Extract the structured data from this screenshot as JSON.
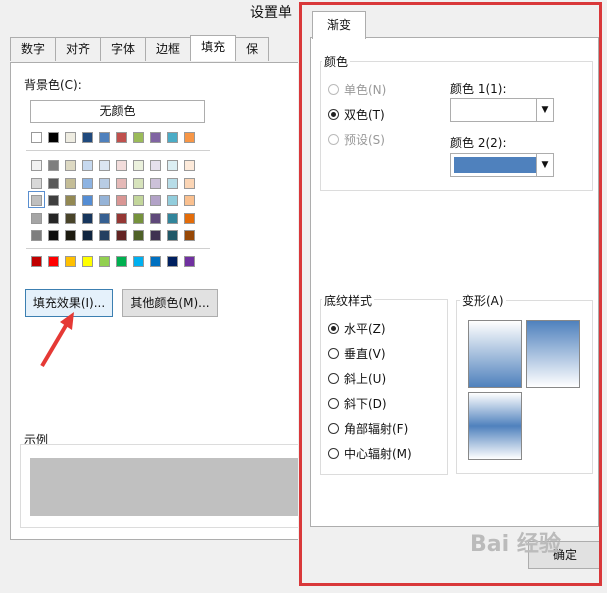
{
  "background_dialog": {
    "title": "设置单",
    "tabs": [
      "数字",
      "对齐",
      "字体",
      "边框",
      "填充",
      "保"
    ],
    "active_tab": "填充",
    "background_color_label": "背景色(C):",
    "no_color_label": "无颜色",
    "fill_effects_button": "填充效果(I)...",
    "other_colors_button": "其他颜色(M)...",
    "example_label": "示例",
    "theme_top_row": [
      "#ffffff",
      "#000000",
      "#eeece1",
      "#1f497d",
      "#4f81bd",
      "#c0504d",
      "#9bbb59",
      "#8064a2",
      "#4bacc6",
      "#f79646"
    ],
    "theme_rows": [
      [
        "#f2f2f2",
        "#7f7f7f",
        "#ddd9c3",
        "#c6d9f0",
        "#dbe5f1",
        "#f2dcdb",
        "#ebf1dd",
        "#e5e0ec",
        "#dbeef3",
        "#fdeada"
      ],
      [
        "#d8d8d8",
        "#595959",
        "#c4bd97",
        "#8db3e2",
        "#b8cce4",
        "#e5b9b7",
        "#d7e3bc",
        "#ccc1d9",
        "#b7dde8",
        "#fbd5b5"
      ],
      [
        "#bfbfbf",
        "#3f3f3f",
        "#938953",
        "#548dd4",
        "#95b3d7",
        "#d99694",
        "#c3d69b",
        "#b2a2c7",
        "#92cddc",
        "#fac08f"
      ],
      [
        "#a5a5a5",
        "#262626",
        "#494429",
        "#17365d",
        "#366092",
        "#953734",
        "#76923c",
        "#5f497a",
        "#31859b",
        "#e36c09"
      ],
      [
        "#7f7f7f",
        "#0c0c0c",
        "#1d1b10",
        "#0f243e",
        "#244061",
        "#632423",
        "#4f6128",
        "#3f3151",
        "#205867",
        "#974806"
      ]
    ],
    "standard_colors": [
      "#c00000",
      "#ff0000",
      "#ffc000",
      "#ffff00",
      "#92d050",
      "#00b050",
      "#00b0f0",
      "#0070c0",
      "#002060",
      "#7030a0"
    ],
    "example_fill": "#c0c0c0"
  },
  "fill_effects_dialog": {
    "tab": "渐变",
    "colors_group": "颜色",
    "color_options": [
      {
        "label": "单色(N)",
        "selected": false,
        "disabled": true
      },
      {
        "label": "双色(T)",
        "selected": true,
        "disabled": false
      },
      {
        "label": "预设(S)",
        "selected": false,
        "disabled": true
      }
    ],
    "color1_label": "颜色 1(1):",
    "color2_label": "颜色 2(2):",
    "color1_value": "#ffffff",
    "color2_value": "#4f81bd",
    "shading_group": "底纹样式",
    "shading_options": [
      {
        "label": "水平(Z)",
        "selected": true
      },
      {
        "label": "垂直(V)",
        "selected": false
      },
      {
        "label": "斜上(U)",
        "selected": false
      },
      {
        "label": "斜下(D)",
        "selected": false
      },
      {
        "label": "角部辐射(F)",
        "selected": false
      },
      {
        "label": "中心辐射(M)",
        "selected": false
      }
    ],
    "variants_label": "变形(A)",
    "ok_button": "确定",
    "highlight_color": "#d9383a"
  },
  "watermark": "Bai 经验"
}
